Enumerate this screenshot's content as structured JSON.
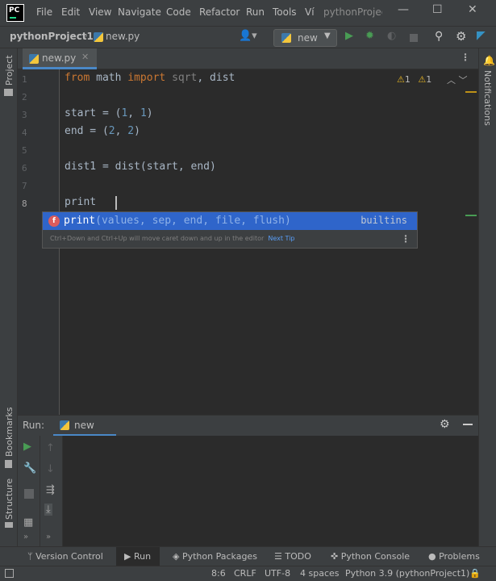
{
  "app": {
    "logo_text": "PC",
    "window_title": "pythonProjec"
  },
  "menu": [
    "File",
    "Edit",
    "View",
    "Navigate",
    "Code",
    "Refactor",
    "Run",
    "Tools",
    "Ví"
  ],
  "navbar": {
    "project": "pythonProject1",
    "file": "new.py",
    "run_config": "new"
  },
  "tab": {
    "label": "new.py"
  },
  "inspections": {
    "warnings": "1",
    "weak_warnings": "1"
  },
  "editor": {
    "line_numbers": [
      "1",
      "2",
      "3",
      "4",
      "5",
      "6",
      "7",
      "8"
    ],
    "current_line": "8",
    "lines": [
      {
        "kw": "from",
        "a": " math ",
        "kw2": "import",
        "b": " sqrt",
        "c": ", dist"
      },
      {},
      {
        "text": "start = (1, 1)"
      },
      {
        "text": "end = (2, 2)"
      },
      {},
      {
        "text": "dist1 = dist(start, end)"
      },
      {},
      {
        "text": "print"
      }
    ]
  },
  "completion": {
    "name": "print",
    "params": "(values, sep, end, file, flush)",
    "source": "builtins",
    "hint": "Ctrl+Down and Ctrl+Up will move caret down and up in the editor",
    "next_tip": "Next Tip"
  },
  "left_strip": {
    "project": "Project",
    "bookmarks": "Bookmarks",
    "structure": "Structure"
  },
  "right_strip": {
    "notifications": "Notifications"
  },
  "run_window": {
    "title": "Run:",
    "tab": "new"
  },
  "tool_tabs": {
    "version_control": "Version Control",
    "run": "Run",
    "python_packages": "Python Packages",
    "todo": "TODO",
    "python_console": "Python Console",
    "problems": "Problems"
  },
  "status": {
    "position": "8:6",
    "line_sep": "CRLF",
    "encoding": "UTF-8",
    "indent": "4 spaces",
    "interpreter": "Python 3.9 (pythonProject1)"
  },
  "colors": {
    "accent": "#4a88c7",
    "keyword": "#cc7832",
    "number": "#6897bb",
    "run_green": "#499c54",
    "selection": "#2f65ca"
  }
}
